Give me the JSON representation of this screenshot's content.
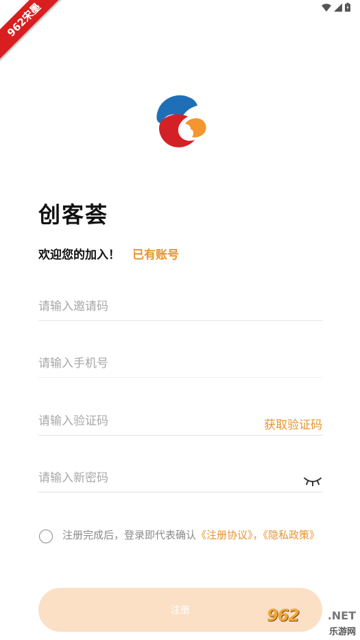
{
  "ribbon": {
    "text": "962宋墨"
  },
  "page": {
    "title": "创客荟",
    "welcome": "欢迎您的加入！",
    "has_account_link": "已有账号"
  },
  "form": {
    "invite_placeholder": "请输入邀请码",
    "phone_placeholder": "请输入手机号",
    "code_placeholder": "请输入验证码",
    "get_code_label": "获取验证码",
    "password_placeholder": "请输入新密码",
    "password_toggle_icon": "eye-closed-icon"
  },
  "agreement": {
    "prefix": "注册完成后，登录即代表确认",
    "terms_link": "《注册协议》",
    "separator": "，",
    "privacy_link": "《隐私政策》",
    "checked": false
  },
  "register_button": {
    "label": "注册"
  },
  "watermark": {
    "top": "962",
    "net": ".NET",
    "bottom": "乐游网"
  },
  "colors": {
    "accent": "#e8932f",
    "button_bg": "#fbe0c6",
    "ribbon": "#d81e1e",
    "logo_blue": "#1f6fb8",
    "logo_red": "#d42128",
    "logo_orange": "#f3962e"
  }
}
